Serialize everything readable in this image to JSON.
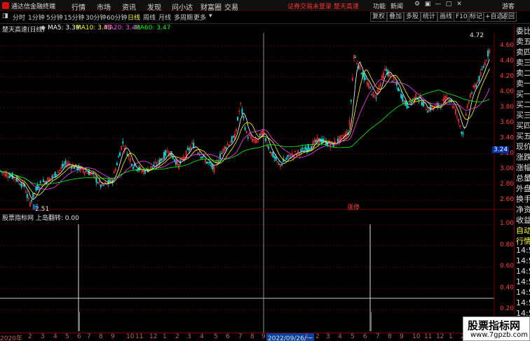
{
  "app": {
    "title": "通达信金融终端"
  },
  "menu": [
    "行情",
    "市场",
    "资讯",
    "发现",
    "问小达",
    "财富圈",
    "交易"
  ],
  "alert": "证券交易未登录  楚天高速",
  "toolbar": {
    "func": "功能",
    "news": "新闻",
    "user": "游客"
  },
  "period_tabs": [
    {
      "label": "分时",
      "active": false
    },
    {
      "label": "1分钟",
      "active": false
    },
    {
      "label": "5分钟",
      "active": false
    },
    {
      "label": "15分钟",
      "active": false
    },
    {
      "label": "30分钟",
      "active": false
    },
    {
      "label": "60分钟",
      "active": false
    },
    {
      "label": "日线",
      "active": true
    },
    {
      "label": "周线",
      "active": false
    },
    {
      "label": "月线",
      "active": false
    },
    {
      "label": "多周期",
      "active": false
    },
    {
      "label": "更多",
      "active": false
    }
  ],
  "right_buttons": [
    "复权",
    "叠加",
    "多股",
    "统计",
    "画线",
    "F10",
    "标记",
    "+自选",
    "返回"
  ],
  "info": {
    "stock": "楚天高速(日线)",
    "ma5": "MA5: 3.39",
    "ma10": "MA10: 3.43",
    "ma20": "MA20: 3.48",
    "ma60": "MA60: 3.47"
  },
  "indicator": {
    "title": "股票指标网 上岛翻转: 0.00"
  },
  "side_panel": [
    "委比",
    "卖五",
    "卖四",
    "卖三",
    "卖二",
    "卖一",
    "买一",
    "买二",
    "买三",
    "买四",
    "买五",
    "现价",
    "涨跌",
    "涨幅",
    "总量",
    "外盘",
    "换手",
    "净资",
    "收益",
    "自动",
    "行情",
    "14:5",
    "14:5",
    "14:5",
    "14:5",
    "14:5",
    "14:5",
    "14:5",
    "14:5"
  ],
  "price_axis": [
    "4.60",
    "4.40",
    "4.20",
    "4.00",
    "3.80",
    "3.60",
    "3.40",
    "3.20",
    "3.00",
    "2.80",
    "2.60"
  ],
  "current_price": "3.24",
  "high_label": "4.72",
  "low_label": "2.51",
  "ind_axis": [
    "1.00",
    "0.80",
    "0.60",
    "0.40",
    "0.20"
  ],
  "x_axis": [
    "2020年",
    "2",
    "3",
    "4",
    "5",
    "6",
    "7",
    "8",
    "9",
    "10",
    "11",
    "12",
    "1",
    "2",
    "3",
    "4",
    "5",
    "6",
    "7",
    "8",
    "9",
    "2022/09/26/一",
    "1",
    "2",
    "3",
    "4",
    "5",
    "6",
    "7",
    "8",
    "9",
    "10",
    "11",
    "12",
    "1",
    "2"
  ],
  "event_labels": [
    {
      "text": "解",
      "idx": 40
    },
    {
      "text": "涨停",
      "idx": 495
    }
  ],
  "watermark": {
    "line1": "股票指标网",
    "line2": "www.7gpzb.com"
  },
  "colors": {
    "up": "#ff3232",
    "down": "#00e0e0",
    "ma5": "#ffffff",
    "ma10": "#ffff00",
    "ma20": "#ff40ff",
    "ma60": "#00ff00"
  },
  "chart_data": {
    "type": "candlestick",
    "y_range": [
      2.5,
      4.75
    ],
    "price_waypoints": [
      [
        0,
        2.98
      ],
      [
        20,
        2.9
      ],
      [
        35,
        2.78
      ],
      [
        42,
        2.55
      ],
      [
        55,
        2.8
      ],
      [
        75,
        2.9
      ],
      [
        95,
        3.08
      ],
      [
        115,
        3.0
      ],
      [
        130,
        2.95
      ],
      [
        145,
        2.78
      ],
      [
        160,
        2.85
      ],
      [
        175,
        3.35
      ],
      [
        190,
        3.05
      ],
      [
        205,
        2.97
      ],
      [
        225,
        3.07
      ],
      [
        240,
        3.25
      ],
      [
        255,
        3.05
      ],
      [
        275,
        3.33
      ],
      [
        290,
        3.15
      ],
      [
        305,
        3.0
      ],
      [
        320,
        3.28
      ],
      [
        335,
        3.42
      ],
      [
        343,
        3.85
      ],
      [
        352,
        3.45
      ],
      [
        365,
        3.35
      ],
      [
        375,
        3.48
      ],
      [
        385,
        3.25
      ],
      [
        398,
        3.05
      ],
      [
        415,
        3.18
      ],
      [
        435,
        3.25
      ],
      [
        455,
        3.38
      ],
      [
        475,
        3.32
      ],
      [
        490,
        3.42
      ],
      [
        498,
        3.5
      ],
      [
        505,
        4.48
      ],
      [
        520,
        4.18
      ],
      [
        535,
        3.92
      ],
      [
        550,
        4.3
      ],
      [
        565,
        4.1
      ],
      [
        580,
        3.82
      ],
      [
        595,
        3.95
      ],
      [
        610,
        3.78
      ],
      [
        625,
        3.82
      ],
      [
        640,
        3.95
      ],
      [
        650,
        3.75
      ],
      [
        660,
        3.45
      ],
      [
        670,
        3.95
      ],
      [
        685,
        4.2
      ],
      [
        698,
        4.55
      ]
    ],
    "signals": [
      {
        "x": 112,
        "value": 1.0
      },
      {
        "x": 528,
        "value": 1.0
      }
    ],
    "indicator_range": [
      0,
      1.1
    ]
  }
}
